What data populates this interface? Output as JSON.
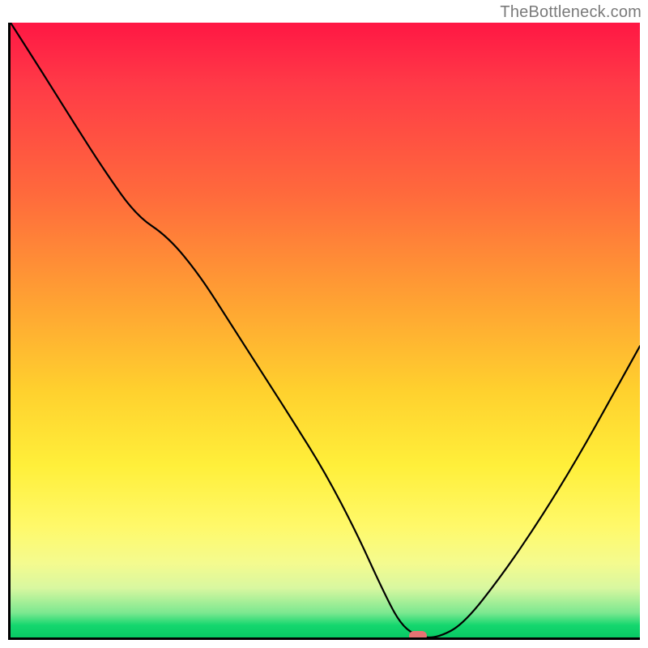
{
  "watermark": "TheBottleneck.com",
  "marker": {
    "x_frac": 0.645,
    "y_frac": 0.994,
    "color": "#e57373"
  },
  "chart_data": {
    "type": "line",
    "title": "",
    "xlabel": "",
    "ylabel": "",
    "xlim": [
      0,
      1
    ],
    "ylim": [
      0,
      1
    ],
    "grid": false,
    "legend": false,
    "background_gradient": {
      "orientation": "vertical",
      "stops": [
        {
          "pos": 0.0,
          "color": "#ff1744"
        },
        {
          "pos": 0.28,
          "color": "#ff6a3c"
        },
        {
          "pos": 0.6,
          "color": "#ffd12e"
        },
        {
          "pos": 0.82,
          "color": "#fff96a"
        },
        {
          "pos": 0.96,
          "color": "#7be890"
        },
        {
          "pos": 1.0,
          "color": "#08c964"
        }
      ]
    },
    "series": [
      {
        "name": "bottleneck-curve",
        "x": [
          0.0,
          0.05,
          0.1,
          0.15,
          0.2,
          0.25,
          0.3,
          0.35,
          0.4,
          0.45,
          0.5,
          0.55,
          0.59,
          0.62,
          0.65,
          0.68,
          0.72,
          0.78,
          0.84,
          0.9,
          0.96,
          1.0
        ],
        "y": [
          1.0,
          0.92,
          0.838,
          0.758,
          0.686,
          0.652,
          0.59,
          0.51,
          0.43,
          0.35,
          0.268,
          0.17,
          0.08,
          0.02,
          0.0,
          0.0,
          0.022,
          0.1,
          0.19,
          0.29,
          0.4,
          0.474
        ]
      }
    ],
    "annotations": [
      {
        "type": "marker-pill",
        "x": 0.645,
        "y": 0.006,
        "color": "#e57373"
      }
    ]
  }
}
